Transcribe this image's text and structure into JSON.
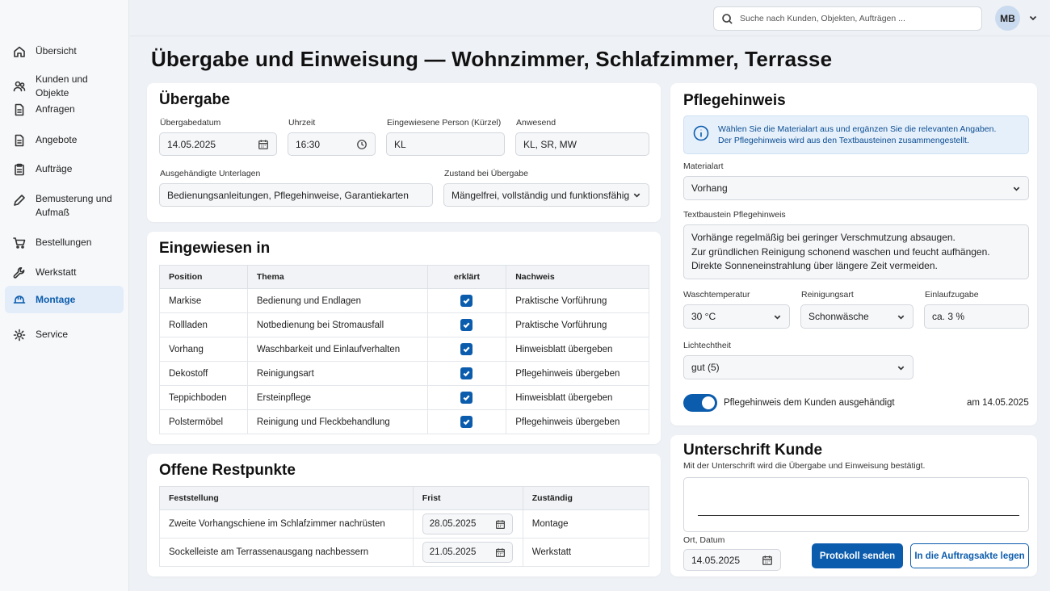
{
  "sidebar": {
    "items": [
      {
        "label": "Übersicht",
        "icon": "home-icon"
      },
      {
        "label": "Kunden und Objekte",
        "icon": "users-icon"
      },
      {
        "label": "Anfragen",
        "icon": "document-icon"
      },
      {
        "label": "Angebote",
        "icon": "document-icon"
      },
      {
        "label": "Aufträge",
        "icon": "clipboard-icon"
      },
      {
        "label": "Bemusterung und Aufmaß",
        "icon": "pen-icon"
      },
      {
        "label": "Bestellungen",
        "icon": "cart-icon"
      },
      {
        "label": "Werkstatt",
        "icon": "wrench-icon"
      },
      {
        "label": "Montage",
        "icon": "hardhat-icon",
        "active": true
      },
      {
        "label": "Service",
        "icon": "gear-icon"
      }
    ]
  },
  "header": {
    "search_placeholder": "Suche nach Kunden, Objekten, Aufträgen ...",
    "avatar_initials": "MB"
  },
  "page": {
    "title": "Übergabe und Einweisung — Wohnzimmer, Schlafzimmer, Terrasse"
  },
  "handover": {
    "title": "Übergabe",
    "date_label": "Übergabedatum",
    "date_value": "14.05.2025",
    "time_label": "Uhrzeit",
    "time_value": "16:30",
    "instructed_label": "Eingewiesene Person (Kürzel)",
    "instructed_value": "KL",
    "present_label": "Anwesend",
    "present_value": "KL, SR, MW",
    "documents_label": "Ausgehändigte Unterlagen",
    "documents_value": "Bedienungsanleitungen, Pflegehinweise, Garantiekarten",
    "condition_label": "Zustand bei Übergabe",
    "condition_value": "Mängelfrei, vollständig und funktionsfähig"
  },
  "instruction": {
    "title": "Eingewiesen in",
    "headers": [
      "Position",
      "Thema",
      "erklärt",
      "Nachweis"
    ],
    "rows": [
      {
        "position": "Markise",
        "topic": "Bedienung und Endlagen",
        "explained": true,
        "proof": "Praktische Vorführung"
      },
      {
        "position": "Rollladen",
        "topic": "Notbedienung bei Stromausfall",
        "explained": true,
        "proof": "Praktische Vorführung"
      },
      {
        "position": "Vorhang",
        "topic": "Waschbarkeit und Einlaufverhalten",
        "explained": true,
        "proof": "Hinweisblatt übergeben"
      },
      {
        "position": "Dekostoff",
        "topic": "Reinigungsart",
        "explained": true,
        "proof": "Pflegehinweis übergeben"
      },
      {
        "position": "Teppichboden",
        "topic": "Ersteinpflege",
        "explained": true,
        "proof": "Hinweisblatt übergeben"
      },
      {
        "position": "Polstermöbel",
        "topic": "Reinigung und Fleckbehandlung",
        "explained": true,
        "proof": "Pflegehinweis übergeben"
      }
    ]
  },
  "open_items": {
    "title": "Offene Restpunkte",
    "headers": [
      "Feststellung",
      "Frist",
      "Zuständig"
    ],
    "rows": [
      {
        "finding": "Zweite Vorhangschiene im Schlafzimmer nachrüsten",
        "deadline": "28.05.2025",
        "responsible": "Montage"
      },
      {
        "finding": "Sockelleiste am Terrassenausgang nachbessern",
        "deadline": "21.05.2025",
        "responsible": "Werkstatt"
      }
    ]
  },
  "care": {
    "title": "Pflegehinweis",
    "info_line1": "Wählen Sie die Materialart aus und ergänzen Sie die relevanten Angaben.",
    "info_line2": "Der Pflegehinweis wird aus den Textbausteinen zusammengestellt.",
    "material_label": "Materialart",
    "material_value": "Vorhang",
    "text_label": "Textbaustein Pflegehinweis",
    "text_lines": [
      "Vorhänge regelmäßig bei geringer Verschmutzung absaugen.",
      "Zur gründlichen Reinigung schonend waschen und feucht aufhängen.",
      "Direkte Sonneneinstrahlung über längere Zeit vermeiden."
    ],
    "wash_temp_label": "Waschtemperatur",
    "wash_temp_value": "30 °C",
    "cleaning_label": "Reinigungsart",
    "cleaning_value": "Schonwäsche",
    "shrink_label": "Einlaufzugabe",
    "shrink_value": "ca. 3 %",
    "lightfast_label": "Lichtechtheit",
    "lightfast_value": "gut (5)",
    "handed_label": "Pflegehinweis dem Kunden ausgehändigt",
    "handed_on": true,
    "handed_date": "am 14.05.2025"
  },
  "signature": {
    "title": "Unterschrift Kunde",
    "subtitle": "Mit der Unterschrift wird die Übergabe und Einweisung bestätigt.",
    "place_date_label": "Ort, Datum",
    "place_date_value": "14.05.2025",
    "send_label": "Protokoll senden",
    "file_label": "In die Auftragsakte legen"
  },
  "colors": {
    "accent": "#0b5cad",
    "active_nav_bg": "#e3edf9",
    "info_bg": "#e6f0fb"
  }
}
